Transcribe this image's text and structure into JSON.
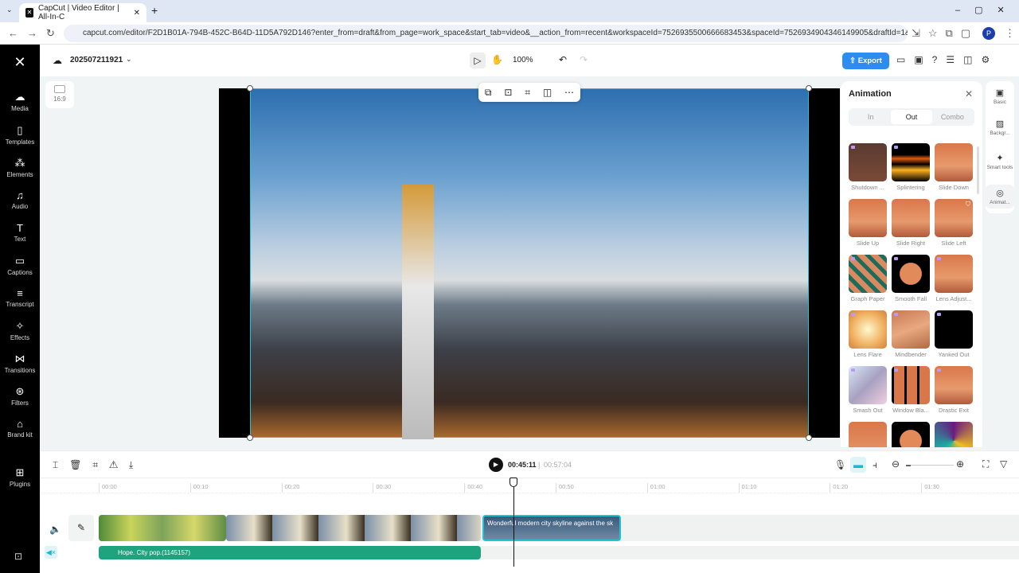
{
  "browser": {
    "tab_title": "CapCut | Video Editor | All-In-C",
    "url": "capcut.com/editor/F2D1B01A-794B-452C-B64D-11D5A792D146?enter_from=draft&from_page=work_space&start_tab=video&__action_from=recent&workspaceId=7526935500666683453&spaceId=7526934904346149905&draftId=1&__from_page..."
  },
  "header": {
    "project_name": "202507211921",
    "zoom": "100%",
    "export_label": "Export"
  },
  "sidebar": {
    "items": [
      {
        "label": "Media",
        "icon": "☁"
      },
      {
        "label": "Templates",
        "icon": "▯"
      },
      {
        "label": "Elements",
        "icon": "⁂"
      },
      {
        "label": "Audio",
        "icon": "♫"
      },
      {
        "label": "Text",
        "icon": "T"
      },
      {
        "label": "Captions",
        "icon": "▭"
      },
      {
        "label": "Transcript",
        "icon": "≡"
      },
      {
        "label": "Effects",
        "icon": "✧"
      },
      {
        "label": "Transitions",
        "icon": "⋈"
      },
      {
        "label": "Filters",
        "icon": "⊛"
      },
      {
        "label": "Brand kit",
        "icon": "⌂"
      },
      {
        "label": "Plugins",
        "icon": "⊞"
      }
    ]
  },
  "canvas": {
    "aspect_ratio": "16:9"
  },
  "animation_panel": {
    "title": "Animation",
    "tabs": [
      "In",
      "Out",
      "Combo"
    ],
    "active_tab": "Out",
    "items": [
      "Shutdown ...",
      "Splintering",
      "Slide Down",
      "Slide Up",
      "Slide Right",
      "Slide Left",
      "Graph Paper",
      "Smooth Fall",
      "Lens Adjust...",
      "Lens Flare",
      "Mindbender",
      "Yanked Out",
      "Smash Out",
      "Window Bla...",
      "Drastic Exit"
    ]
  },
  "right_tools": [
    {
      "label": "Basic",
      "icon": "▣"
    },
    {
      "label": "Backgr...",
      "icon": "▨"
    },
    {
      "label": "Smart tools",
      "icon": "✦"
    },
    {
      "label": "Animat...",
      "icon": "◎"
    }
  ],
  "timeline": {
    "current_time": "00:45:11",
    "total_time": "00:57:04",
    "ruler": [
      "00:00",
      "00:10",
      "00:20",
      "00:30",
      "00:40",
      "00:50",
      "01:00",
      "01:10",
      "01:20",
      "01:30"
    ],
    "clip_title": "Wonderful modern city skyline against the sk",
    "audio_title": "Hope. City pop.(1145157)"
  }
}
